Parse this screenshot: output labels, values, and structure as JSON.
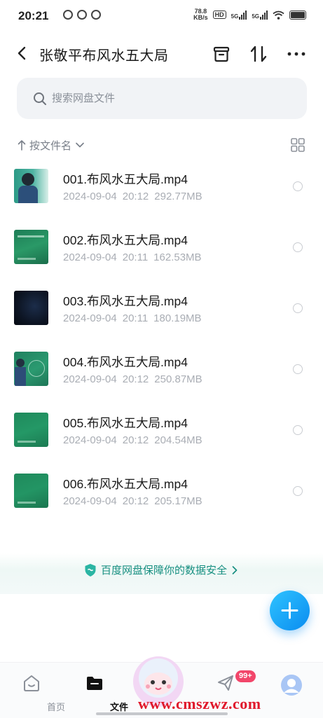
{
  "status_bar": {
    "time": "20:21",
    "net_speed_value": "78.8",
    "net_speed_unit": "KB/s",
    "hd_label": "HD",
    "signal1_label": "5G",
    "signal2_label": "5G"
  },
  "header": {
    "title": "张敬平布风水五大局"
  },
  "search": {
    "placeholder": "搜索网盘文件"
  },
  "sort": {
    "label": "按文件名"
  },
  "files": [
    {
      "name": "001.布风水五大局.mp4",
      "date": "2024-09-04",
      "time": "20:12",
      "size": "292.77MB"
    },
    {
      "name": "002.布风水五大局.mp4",
      "date": "2024-09-04",
      "time": "20:11",
      "size": "162.53MB"
    },
    {
      "name": "003.布风水五大局.mp4",
      "date": "2024-09-04",
      "time": "20:11",
      "size": "180.19MB"
    },
    {
      "name": "004.布风水五大局.mp4",
      "date": "2024-09-04",
      "time": "20:12",
      "size": "250.87MB"
    },
    {
      "name": "005.布风水五大局.mp4",
      "date": "2024-09-04",
      "time": "20:12",
      "size": "204.54MB"
    },
    {
      "name": "006.布风水五大局.mp4",
      "date": "2024-09-04",
      "time": "20:12",
      "size": "205.17MB"
    }
  ],
  "safety_banner": {
    "text": "百度网盘保障你的数据安全"
  },
  "bottom_nav": {
    "home_label": "首页",
    "files_label": "文件",
    "share_badge": "99+"
  },
  "watermark": "www.cmszwz.com",
  "colors": {
    "accent": "#0a8cf0",
    "safety_text": "#178f81",
    "badge": "#f2466a",
    "watermark": "#e0182b"
  }
}
